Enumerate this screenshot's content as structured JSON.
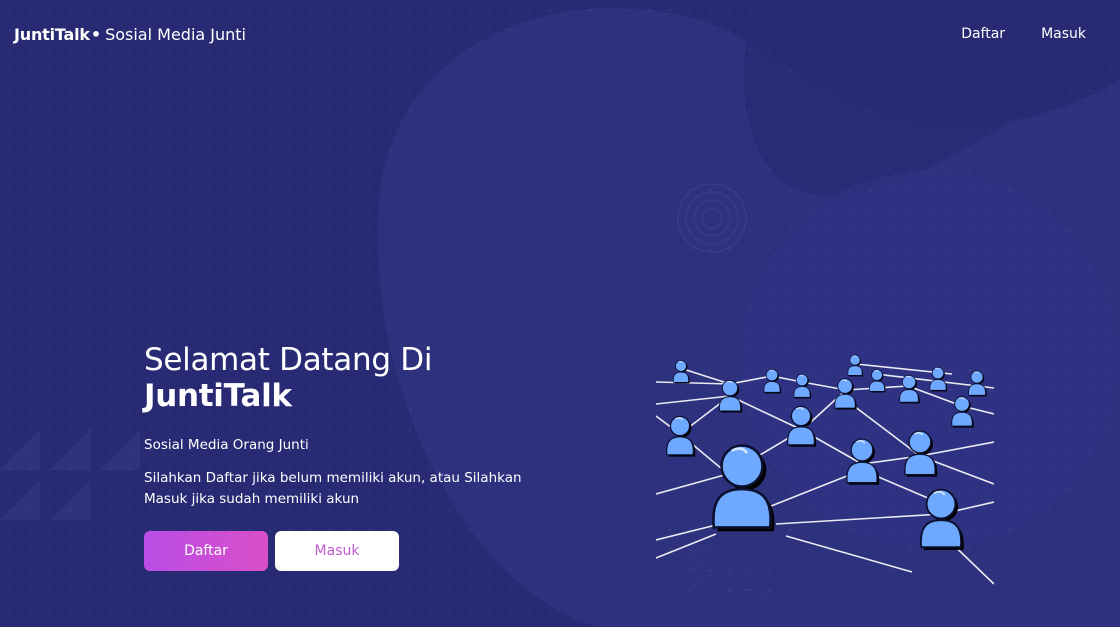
{
  "navbar": {
    "brand": "JuntiTalk",
    "brand_dot": "•",
    "brand_subtitle": "Sosial Media Junti",
    "links": [
      {
        "label": "Daftar"
      },
      {
        "label": "Masuk"
      }
    ]
  },
  "hero": {
    "title_line1": "Selamat Datang Di",
    "title_line2": "JuntiTalk",
    "subtitle": "Sosial Media Orang Junti",
    "description": "Silahkan Daftar jika belum memiliki akun, atau Silahkan Masuk jika sudah memiliki akun",
    "primary_button": "Daftar",
    "secondary_button": "Masuk"
  },
  "colors": {
    "background": "#282b74",
    "accent_gradient_start": "#b94ee6",
    "accent_gradient_end": "#d94fc8",
    "person_fill": "#6ea8ff"
  },
  "illustration": {
    "icon": "social-network-people-icon"
  }
}
